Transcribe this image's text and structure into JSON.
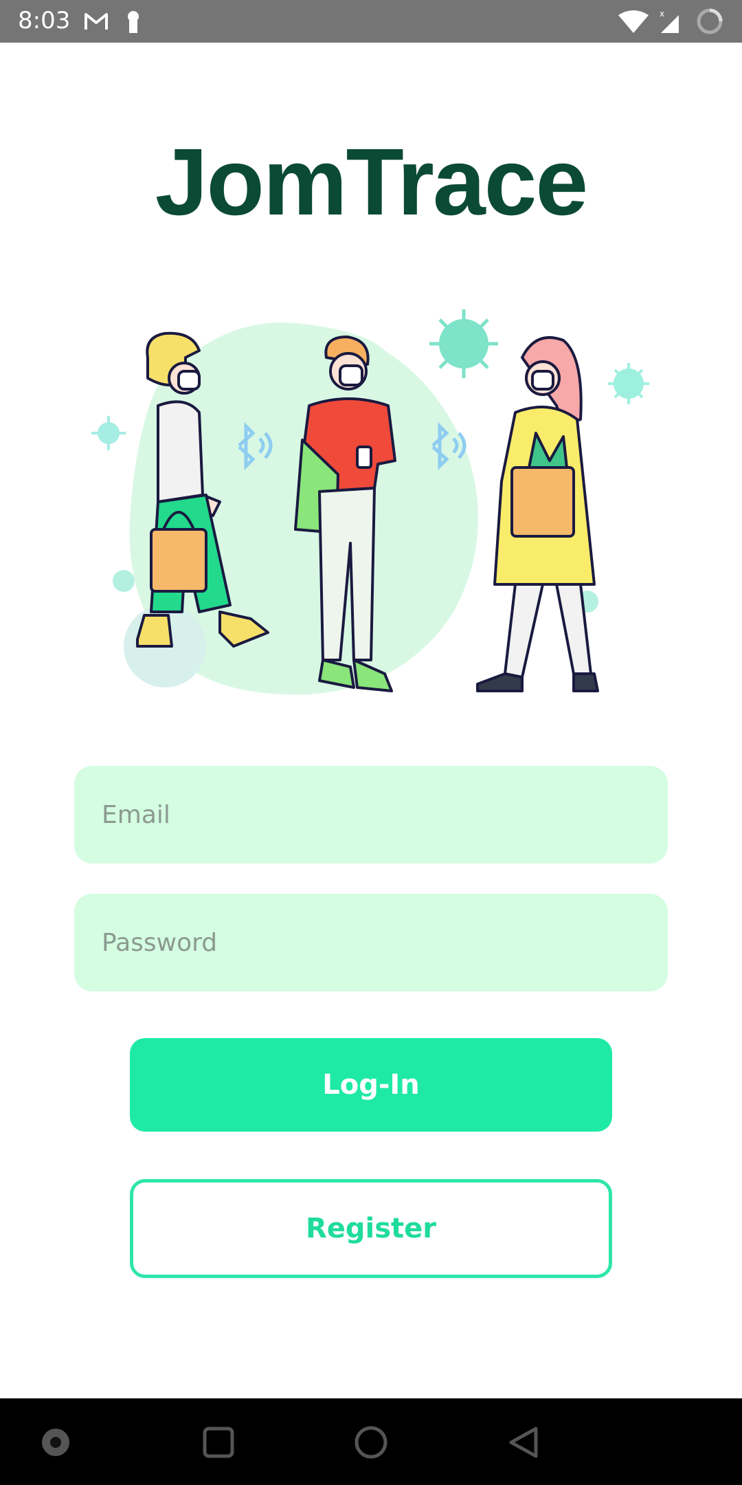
{
  "status_bar": {
    "time": "8:03",
    "icons": [
      "gmail-icon",
      "key-notification-icon",
      "wifi-icon",
      "signal-icon",
      "battery-loading-icon"
    ],
    "background": "#757575"
  },
  "app": {
    "title": "JomTrace",
    "title_color": "#0b4a35"
  },
  "illustration": {
    "icons": [
      "person-walking-bag-icon",
      "person-with-phone-icon",
      "person-with-groceries-icon",
      "bluetooth-signal-icon",
      "virus-icon"
    ]
  },
  "login_form": {
    "email": {
      "placeholder": "Email",
      "value": ""
    },
    "password": {
      "placeholder": "Password",
      "value": ""
    },
    "field_color": "#d4fde2"
  },
  "buttons": {
    "login_label": "Log-In",
    "register_label": "Register",
    "accent": "#1eeaa6"
  },
  "nav_bar": {
    "items": [
      "record-icon",
      "recents-icon",
      "home-icon",
      "back-icon"
    ]
  }
}
